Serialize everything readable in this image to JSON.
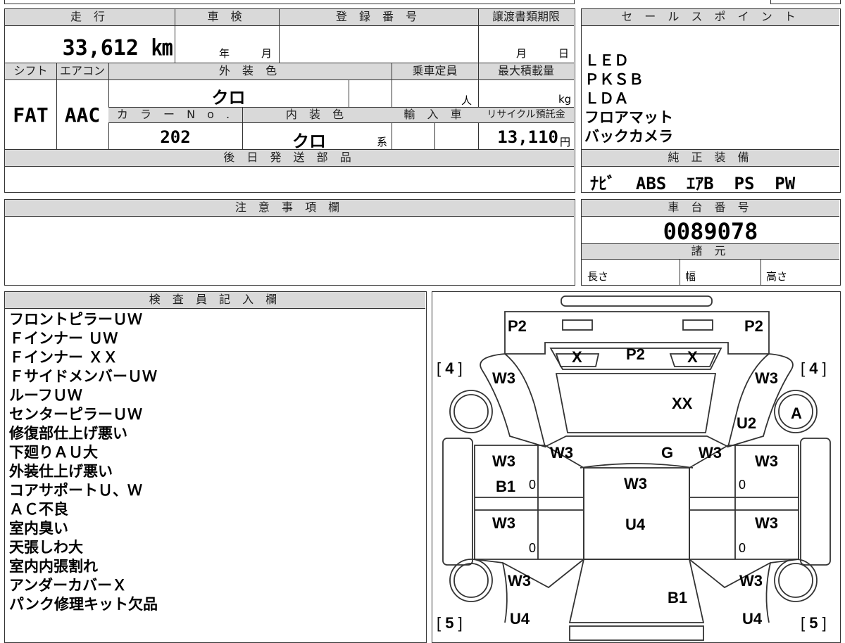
{
  "vehicle": {
    "mileage_label": "走 行",
    "mileage_value": "33,612 ㎞",
    "shaken_label": "車 検",
    "shaken_year": "年",
    "shaken_month": "月",
    "reg_label": "登 録 番 号",
    "transfer_label": "譲渡書類期限",
    "transfer_month": "月",
    "transfer_day": "日",
    "shift_label": "シフト",
    "shift_value": "FAT",
    "ac_label": "エアコン",
    "ac_value": "AAC",
    "exterior_label": "外 装 色",
    "exterior_value": "クロ",
    "capacity_label": "乗車定員",
    "capacity_unit": "人",
    "maxload_label": "最大積載量",
    "maxload_unit": "kg",
    "colorno_label": "カ ラ ー N o .",
    "colorno_value": "202",
    "interior_label": "内 装 色",
    "interior_value": "クロ",
    "interior_suffix": "系",
    "import_label": "輸 入 車",
    "recycle_label": "リサイクル預託金",
    "recycle_value": "13,110",
    "recycle_unit": "円",
    "later_parts_label": "後 日 発 送 部 品"
  },
  "sales_points": {
    "label": "セ ー ル ス ポ イ ン ト",
    "items": [
      "ＬＥＤ",
      "ＰＫＳＢ",
      "ＬＤＡ",
      "フロアマット",
      "バックカメラ"
    ]
  },
  "genuine": {
    "label": "純 正 装 備",
    "value": "ﾅﾋﾞ  ABS  ｴｱB  PS  PW"
  },
  "notes": {
    "label": "注 意 事 項 欄"
  },
  "chassis": {
    "label": "車 台 番 号",
    "value": "0089078",
    "spec_label": "諸 元",
    "length_label": "長さ",
    "width_label": "幅",
    "height_label": "高さ"
  },
  "inspector": {
    "label": "検 査 員 記 入 欄",
    "items": [
      "フロントピラーＵＷ",
      "Ｆインナー ＵＷ",
      "Ｆインナー ＸＸ",
      "ＦサイドメンバーＵＷ",
      "ルーフＵＷ",
      "センターピラーＵＷ",
      "修復部仕上げ悪い",
      "下廻りＡＵ大",
      "外装仕上げ悪い",
      "コアサポートＵ、Ｗ",
      "ＡＣ不良",
      "室内臭い",
      "天張しわ大",
      "室内内張割れ",
      "アンダーカバーＸ",
      "パンク修理キット欠品"
    ]
  },
  "diagram": {
    "p2_left": "P2",
    "p2_right": "P2",
    "p2_center": "P2",
    "x_left": "X",
    "x_right": "X",
    "xx": "XX",
    "u2": "U2",
    "a": "A",
    "g": "G",
    "w3_fl_top": "W3",
    "w3_fr_top": "W3",
    "w3_fl_pillar": "W3",
    "w3_fr_pillar": "W3",
    "w3_ld1": "W3",
    "w3_rd1": "W3",
    "b1_left": "B1",
    "w3_roof": "W3",
    "u4_center": "U4",
    "w3_ld2": "W3",
    "w3_rd2": "W3",
    "w3_rl": "W3",
    "w3_rr": "W3",
    "u4_left": "U4",
    "u4_right": "U4",
    "b1_rear": "B1",
    "zero_1": "0",
    "zero_2": "0",
    "zero_3": "0",
    "zero_4": "0",
    "tire_fl": "4",
    "tire_fr": "4",
    "tire_rl": "5",
    "tire_rr": "5"
  }
}
